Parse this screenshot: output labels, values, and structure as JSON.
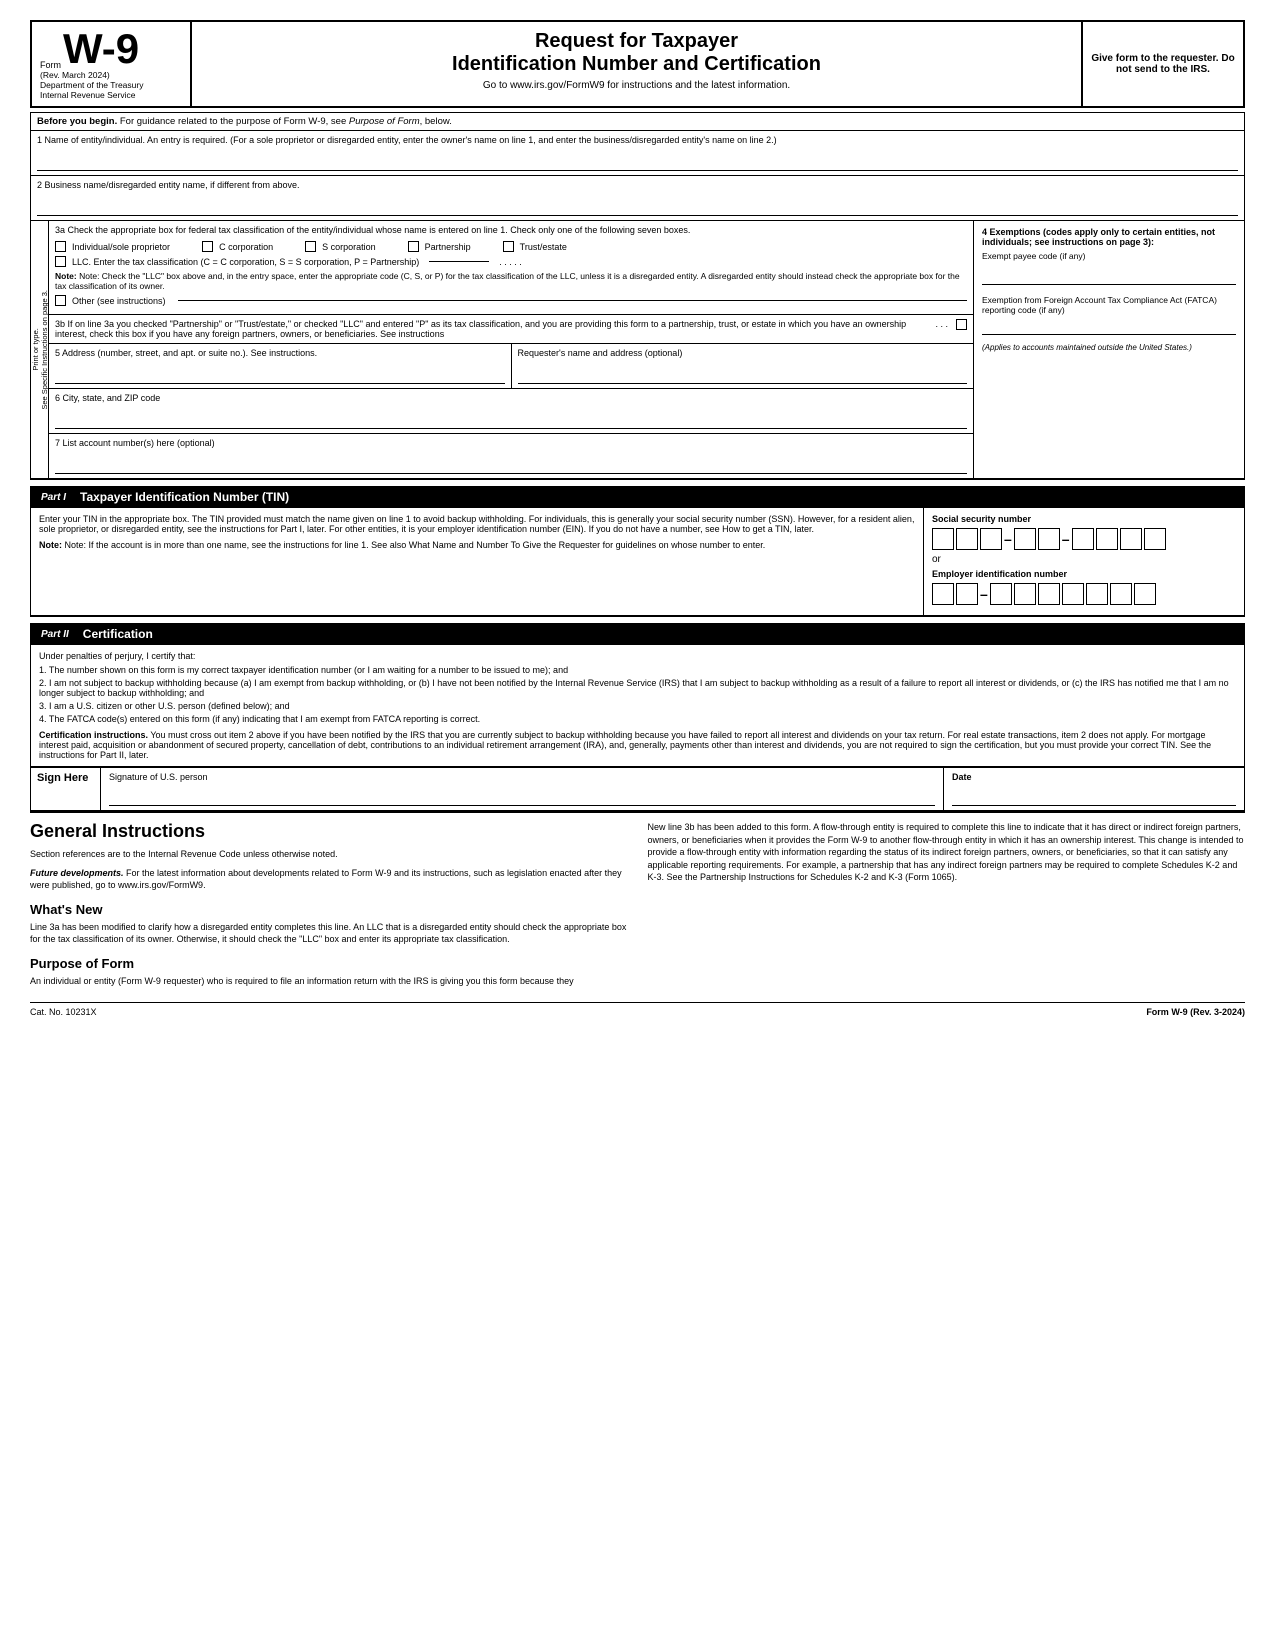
{
  "header": {
    "form_label": "Form",
    "form_number": "W-9",
    "rev_date": "(Rev. March 2024)",
    "dept": "Department of the Treasury",
    "irs": "Internal Revenue Service",
    "title1": "Request for Taxpayer",
    "title2": "Identification Number and Certification",
    "website_note": "Go to www.irs.gov/FormW9 for instructions and the latest information.",
    "give_form": "Give form to the requester. Do not send to the IRS."
  },
  "before_begin": {
    "text": "Before you begin. For guidance related to the purpose of Form W-9, see Purpose of Form, below."
  },
  "fields": {
    "line1_label": "1  Name of entity/individual. An entry is required. (For a sole proprietor or disregarded entity, enter the owner's name on line 1, and enter the business/disregarded entity's name on line 2.)",
    "line2_label": "2  Business name/disregarded entity name, if different from above.",
    "line3a_label": "3a Check the appropriate box for federal tax classification of the entity/individual whose name is entered on line 1. Check only one of the following seven boxes.",
    "cb1_label": "Individual/sole proprietor",
    "cb2_label": "C corporation",
    "cb3_label": "S corporation",
    "cb4_label": "Partnership",
    "cb5_label": "Trust/estate",
    "llc_label": "LLC. Enter the tax classification (C = C corporation, S = S corporation, P = Partnership)",
    "note_label": "Note: Check the \"LLC\" box above and, in the entry space, enter the appropriate code (C, S, or P) for the tax classification of the LLC, unless it is a disregarded entity. A disregarded entity should instead check the appropriate box for the tax classification of its owner.",
    "other_label": "Other (see instructions)",
    "line3b_label": "3b If on line 3a you checked \"Partnership\" or \"Trust/estate,\" or checked \"LLC\" and entered \"P\" as its tax classification, and you are providing this form to a partnership, trust, or estate in which you have an ownership interest, check this box if you have any foreign partners, owners, or beneficiaries. See instructions",
    "line5_label": "5  Address (number, street, and apt. or suite no.). See instructions.",
    "line5_right": "Requester's name and address (optional)",
    "line6_label": "6  City, state, and ZIP code",
    "line7_label": "7  List account number(s) here (optional)",
    "exemptions_title": "4 Exemptions (codes apply only to certain entities, not individuals; see instructions on page 3):",
    "exempt_payee": "Exempt payee code (if any)",
    "fatca_label": "Exemption from Foreign Account Tax Compliance Act (FATCA) reporting code (if any)",
    "applies_label": "(Applies to accounts maintained outside the United States.)"
  },
  "side_label": {
    "text": "See Specific Instructions on page 3."
  },
  "part1": {
    "part_label": "Part I",
    "title": "Taxpayer Identification Number (TIN)",
    "body": "Enter your TIN in the appropriate box. The TIN provided must match the name given on line 1 to avoid backup withholding. For individuals, this is generally your social security number (SSN). However, for a resident alien, sole proprietor, or disregarded entity, see the instructions for Part I, later. For other entities, it is your employer identification number (EIN). If you do not have a number, see How to get a TIN, later.",
    "note": "Note: If the account is in more than one name, see the instructions for line 1. See also What Name and Number To Give the Requester for guidelines on whose number to enter.",
    "ssn_label": "Social security number",
    "or_text": "or",
    "ein_label": "Employer identification number"
  },
  "part2": {
    "part_label": "Part II",
    "title": "Certification",
    "under_penalty": "Under penalties of perjury, I certify that:",
    "item1": "1. The number shown on this form is my correct taxpayer identification number (or I am waiting for a number to be issued to me); and",
    "item2": "2. I am not subject to backup withholding because (a) I am exempt from backup withholding, or (b) I have not been notified by the Internal Revenue Service (IRS) that I am subject to backup withholding as a result of a failure to report all interest or dividends, or (c) the IRS has notified me that I am no longer subject to backup withholding; and",
    "item3": "3. I am a U.S. citizen or other U.S. person (defined below); and",
    "item4": "4. The FATCA code(s) entered on this form (if any) indicating that I am exempt from FATCA reporting is correct.",
    "cert_instructions_bold": "Certification instructions.",
    "cert_instructions": "You must cross out item 2 above if you have been notified by the IRS that you are currently subject to backup withholding because you have failed to report all interest and dividends on your tax return. For real estate transactions, item 2 does not apply. For mortgage interest paid, acquisition or abandonment of secured property, cancellation of debt, contributions to an individual retirement arrangement (IRA), and, generally, payments other than interest and dividends, you are not required to sign the certification, but you must provide your correct TIN. See the instructions for Part II, later."
  },
  "sign_here": {
    "label": "Sign Here",
    "signature_label": "Signature of U.S. person",
    "date_label": "Date"
  },
  "general_instructions": {
    "heading": "General Instructions",
    "para1": "Section references are to the Internal Revenue Code unless otherwise noted.",
    "future_bold": "Future developments.",
    "future_text": "For the latest information about developments related to Form W-9 and its instructions, such as legislation enacted after they were published, go to www.irs.gov/FormW9.",
    "whats_new_heading": "What's New",
    "whats_new_text": "Line 3a has been modified to clarify how a disregarded entity completes this line. An LLC that is a disregarded entity should check the appropriate box for the tax classification of its owner. Otherwise, it should check the \"LLC\" box and enter its appropriate tax classification.",
    "purpose_heading": "Purpose of Form",
    "purpose_text": "An individual or entity (Form W-9 requester) who is required to file an information return with the IRS is giving you this form because they",
    "new_line_3b": "New line 3b has been added to this form. A flow-through entity is required to complete this line to indicate that it has direct or indirect foreign partners, owners, or beneficiaries when it provides the Form W-9 to another flow-through entity in which it has an ownership interest. This change is intended to provide a flow-through entity with information regarding the status of its indirect foreign partners, owners, or beneficiaries, so that it can satisfy any applicable reporting requirements. For example, a partnership that has any indirect foreign partners may be required to complete Schedules K-2 and K-3. See the Partnership Instructions for Schedules K-2 and K-3 (Form 1065)."
  },
  "footer": {
    "cat_no": "Cat. No. 10231X",
    "form_ref": "Form W-9 (Rev. 3-2024)"
  }
}
